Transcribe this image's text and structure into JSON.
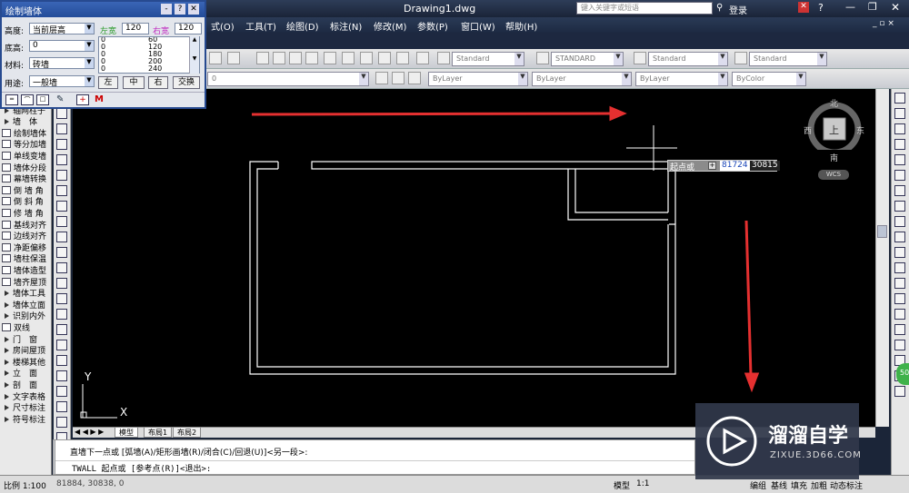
{
  "app": {
    "file_title": "Drawing1.dwg",
    "search_placeholder": "键入关键字或短语",
    "login": "登录",
    "help": "?"
  },
  "menu": [
    {
      "label": "式(O)"
    },
    {
      "label": "工具(T)"
    },
    {
      "label": "绘图(D)"
    },
    {
      "label": "标注(N)"
    },
    {
      "label": "修改(M)"
    },
    {
      "label": "参数(P)"
    },
    {
      "label": "窗口(W)"
    },
    {
      "label": "帮助(H)"
    }
  ],
  "toolbar": {
    "standard_1": "Standard",
    "standard_2": "STANDARD",
    "standard_3": "Standard",
    "standard_4": "Standard",
    "layer": "0",
    "bylayer_1": "ByLayer",
    "bylayer_2": "ByLayer",
    "bylayer_3": "ByLayer",
    "bycolor": "ByColor"
  },
  "wall_panel": {
    "title": "绘制墙体",
    "height_label": "高度:",
    "height_value": "当前层高",
    "left_width_label": "左宽",
    "left_width_value": "120",
    "right_width_label": "右宽",
    "right_width_value": "120",
    "base_label": "底高:",
    "base_value": "0",
    "material_label": "材料:",
    "material_value": "砖墙",
    "usage_label": "用途:",
    "usage_value": "一般墙",
    "width_list": [
      {
        "l": "0",
        "r": "60"
      },
      {
        "l": "0",
        "r": "120"
      },
      {
        "l": "0",
        "r": "180"
      },
      {
        "l": "0",
        "r": "200"
      },
      {
        "l": "0",
        "r": "240"
      }
    ],
    "btn_left": "左",
    "btn_center": "中",
    "btn_right": "右",
    "btn_swap": "交换"
  },
  "left_menu": [
    {
      "label": "设　置",
      "kind": "tri"
    },
    {
      "label": "轴网柱子",
      "kind": "tri"
    },
    {
      "label": "墙　体",
      "kind": "tri"
    },
    {
      "label": "绘制墙体",
      "kind": "ic"
    },
    {
      "label": "等分加墙",
      "kind": "ic"
    },
    {
      "label": "单线变墙",
      "kind": "ic"
    },
    {
      "label": "墙体分段",
      "kind": "ic"
    },
    {
      "label": "幕墙转换",
      "kind": "ic"
    },
    {
      "label": "倒 墙 角",
      "kind": "ic"
    },
    {
      "label": "倒 斜 角",
      "kind": "ic"
    },
    {
      "label": "修 墙 角",
      "kind": "ic"
    },
    {
      "label": "基线对齐",
      "kind": "ic"
    },
    {
      "label": "边线对齐",
      "kind": "ic"
    },
    {
      "label": "净距偏移",
      "kind": "ic"
    },
    {
      "label": "墙柱保温",
      "kind": "ic"
    },
    {
      "label": "墙体造型",
      "kind": "ic"
    },
    {
      "label": "墙齐屋顶",
      "kind": "ic"
    },
    {
      "label": "墙体工具",
      "kind": "tri"
    },
    {
      "label": "墙体立面",
      "kind": "tri"
    },
    {
      "label": "识别内外",
      "kind": "tri"
    },
    {
      "label": "双线",
      "kind": "ic"
    },
    {
      "label": "门　窗",
      "kind": "tri"
    },
    {
      "label": "房间屋顶",
      "kind": "tri"
    },
    {
      "label": "楼梯其他",
      "kind": "tri"
    },
    {
      "label": "立　面",
      "kind": "tri"
    },
    {
      "label": "剖　面",
      "kind": "tri"
    },
    {
      "label": "文字表格",
      "kind": "tri"
    },
    {
      "label": "尺寸标注",
      "kind": "tri"
    },
    {
      "label": "符号标注",
      "kind": "tri"
    }
  ],
  "canvas": {
    "prompt": "起点或",
    "input_value": "81724",
    "coord_y": "30815",
    "axis_y": "Y",
    "axis_x": "X"
  },
  "compass": {
    "north": "北",
    "south": "南",
    "east": "东",
    "west": "西",
    "center": "上",
    "wcs": "WCS"
  },
  "tabs": [
    "模型",
    "布局1",
    "布局2"
  ],
  "command": {
    "line1": "直墙下一点或 [弧墙(A)/矩形画墙(R)/闭合(C)/回退(U)]<另一段>:",
    "line2": "TWALL 起点或 [参考点(R)]<退出>:"
  },
  "status": {
    "scale": "比例 1:100",
    "coords": "81884, 30838, 0",
    "model": "模型",
    "ratio": "1:1",
    "items": [
      "编组",
      "基线",
      "填充",
      "加粗",
      "动态标注"
    ]
  },
  "watermark": {
    "brand": "溜溜自学",
    "url": "ZIXUE.3D66.COM"
  },
  "colors": {
    "canvas": "#000000",
    "red_arrow": "#e53030",
    "title_blue": "#274a90",
    "panel_bg": "#e3e6ec",
    "wall_line": "#ffffff",
    "accent_green": "#3fb24a"
  }
}
